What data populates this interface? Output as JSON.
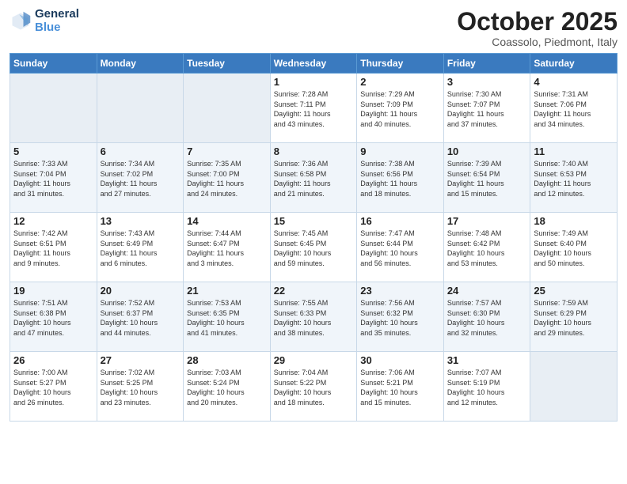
{
  "logo": {
    "line1": "General",
    "line2": "Blue"
  },
  "title": "October 2025",
  "subtitle": "Coassolo, Piedmont, Italy",
  "days_of_week": [
    "Sunday",
    "Monday",
    "Tuesday",
    "Wednesday",
    "Thursday",
    "Friday",
    "Saturday"
  ],
  "weeks": [
    [
      {
        "day": "",
        "info": ""
      },
      {
        "day": "",
        "info": ""
      },
      {
        "day": "",
        "info": ""
      },
      {
        "day": "1",
        "info": "Sunrise: 7:28 AM\nSunset: 7:11 PM\nDaylight: 11 hours\nand 43 minutes."
      },
      {
        "day": "2",
        "info": "Sunrise: 7:29 AM\nSunset: 7:09 PM\nDaylight: 11 hours\nand 40 minutes."
      },
      {
        "day": "3",
        "info": "Sunrise: 7:30 AM\nSunset: 7:07 PM\nDaylight: 11 hours\nand 37 minutes."
      },
      {
        "day": "4",
        "info": "Sunrise: 7:31 AM\nSunset: 7:06 PM\nDaylight: 11 hours\nand 34 minutes."
      }
    ],
    [
      {
        "day": "5",
        "info": "Sunrise: 7:33 AM\nSunset: 7:04 PM\nDaylight: 11 hours\nand 31 minutes."
      },
      {
        "day": "6",
        "info": "Sunrise: 7:34 AM\nSunset: 7:02 PM\nDaylight: 11 hours\nand 27 minutes."
      },
      {
        "day": "7",
        "info": "Sunrise: 7:35 AM\nSunset: 7:00 PM\nDaylight: 11 hours\nand 24 minutes."
      },
      {
        "day": "8",
        "info": "Sunrise: 7:36 AM\nSunset: 6:58 PM\nDaylight: 11 hours\nand 21 minutes."
      },
      {
        "day": "9",
        "info": "Sunrise: 7:38 AM\nSunset: 6:56 PM\nDaylight: 11 hours\nand 18 minutes."
      },
      {
        "day": "10",
        "info": "Sunrise: 7:39 AM\nSunset: 6:54 PM\nDaylight: 11 hours\nand 15 minutes."
      },
      {
        "day": "11",
        "info": "Sunrise: 7:40 AM\nSunset: 6:53 PM\nDaylight: 11 hours\nand 12 minutes."
      }
    ],
    [
      {
        "day": "12",
        "info": "Sunrise: 7:42 AM\nSunset: 6:51 PM\nDaylight: 11 hours\nand 9 minutes."
      },
      {
        "day": "13",
        "info": "Sunrise: 7:43 AM\nSunset: 6:49 PM\nDaylight: 11 hours\nand 6 minutes."
      },
      {
        "day": "14",
        "info": "Sunrise: 7:44 AM\nSunset: 6:47 PM\nDaylight: 11 hours\nand 3 minutes."
      },
      {
        "day": "15",
        "info": "Sunrise: 7:45 AM\nSunset: 6:45 PM\nDaylight: 10 hours\nand 59 minutes."
      },
      {
        "day": "16",
        "info": "Sunrise: 7:47 AM\nSunset: 6:44 PM\nDaylight: 10 hours\nand 56 minutes."
      },
      {
        "day": "17",
        "info": "Sunrise: 7:48 AM\nSunset: 6:42 PM\nDaylight: 10 hours\nand 53 minutes."
      },
      {
        "day": "18",
        "info": "Sunrise: 7:49 AM\nSunset: 6:40 PM\nDaylight: 10 hours\nand 50 minutes."
      }
    ],
    [
      {
        "day": "19",
        "info": "Sunrise: 7:51 AM\nSunset: 6:38 PM\nDaylight: 10 hours\nand 47 minutes."
      },
      {
        "day": "20",
        "info": "Sunrise: 7:52 AM\nSunset: 6:37 PM\nDaylight: 10 hours\nand 44 minutes."
      },
      {
        "day": "21",
        "info": "Sunrise: 7:53 AM\nSunset: 6:35 PM\nDaylight: 10 hours\nand 41 minutes."
      },
      {
        "day": "22",
        "info": "Sunrise: 7:55 AM\nSunset: 6:33 PM\nDaylight: 10 hours\nand 38 minutes."
      },
      {
        "day": "23",
        "info": "Sunrise: 7:56 AM\nSunset: 6:32 PM\nDaylight: 10 hours\nand 35 minutes."
      },
      {
        "day": "24",
        "info": "Sunrise: 7:57 AM\nSunset: 6:30 PM\nDaylight: 10 hours\nand 32 minutes."
      },
      {
        "day": "25",
        "info": "Sunrise: 7:59 AM\nSunset: 6:29 PM\nDaylight: 10 hours\nand 29 minutes."
      }
    ],
    [
      {
        "day": "26",
        "info": "Sunrise: 7:00 AM\nSunset: 5:27 PM\nDaylight: 10 hours\nand 26 minutes."
      },
      {
        "day": "27",
        "info": "Sunrise: 7:02 AM\nSunset: 5:25 PM\nDaylight: 10 hours\nand 23 minutes."
      },
      {
        "day": "28",
        "info": "Sunrise: 7:03 AM\nSunset: 5:24 PM\nDaylight: 10 hours\nand 20 minutes."
      },
      {
        "day": "29",
        "info": "Sunrise: 7:04 AM\nSunset: 5:22 PM\nDaylight: 10 hours\nand 18 minutes."
      },
      {
        "day": "30",
        "info": "Sunrise: 7:06 AM\nSunset: 5:21 PM\nDaylight: 10 hours\nand 15 minutes."
      },
      {
        "day": "31",
        "info": "Sunrise: 7:07 AM\nSunset: 5:19 PM\nDaylight: 10 hours\nand 12 minutes."
      },
      {
        "day": "",
        "info": ""
      }
    ]
  ]
}
